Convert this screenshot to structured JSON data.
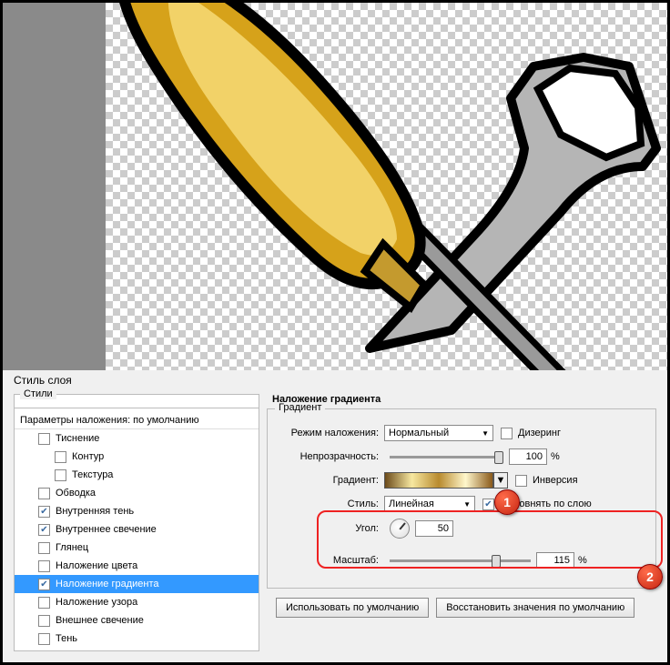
{
  "dialog": {
    "title": "Стиль слоя"
  },
  "styles_panel": {
    "header": "Стили"
  },
  "style_items": {
    "blend_defaults": "Параметры наложения: по умолчанию",
    "bevel": "Тиснение",
    "contour": "Контур",
    "texture": "Текстура",
    "stroke": "Обводка",
    "inner_shadow": "Внутренняя тень",
    "inner_glow": "Внутреннее свечение",
    "satin": "Глянец",
    "color_overlay": "Наложение цвета",
    "gradient_overlay": "Наложение градиента",
    "pattern_overlay": "Наложение узора",
    "outer_glow": "Внешнее свечение",
    "drop_shadow": "Тень"
  },
  "section": {
    "title": "Наложение градиента"
  },
  "fieldset": {
    "legend": "Градиент"
  },
  "labels": {
    "blend_mode": "Режим наложения:",
    "opacity": "Непрозрачность:",
    "gradient": "Градиент:",
    "style": "Стиль:",
    "angle": "Угол:",
    "scale": "Масштаб:"
  },
  "values": {
    "blend_mode": "Нормальный",
    "opacity": "100",
    "style": "Линейная",
    "angle": "50",
    "scale": "115"
  },
  "checks": {
    "dither": "Дизеринг",
    "reverse": "Инверсия",
    "align": "Выровнять по слою"
  },
  "buttons": {
    "make_default": "Использовать по умолчанию",
    "reset_default": "Восстановить значения по умолчанию"
  },
  "unit": {
    "percent": "%"
  },
  "callouts": {
    "one": "1",
    "two": "2"
  }
}
